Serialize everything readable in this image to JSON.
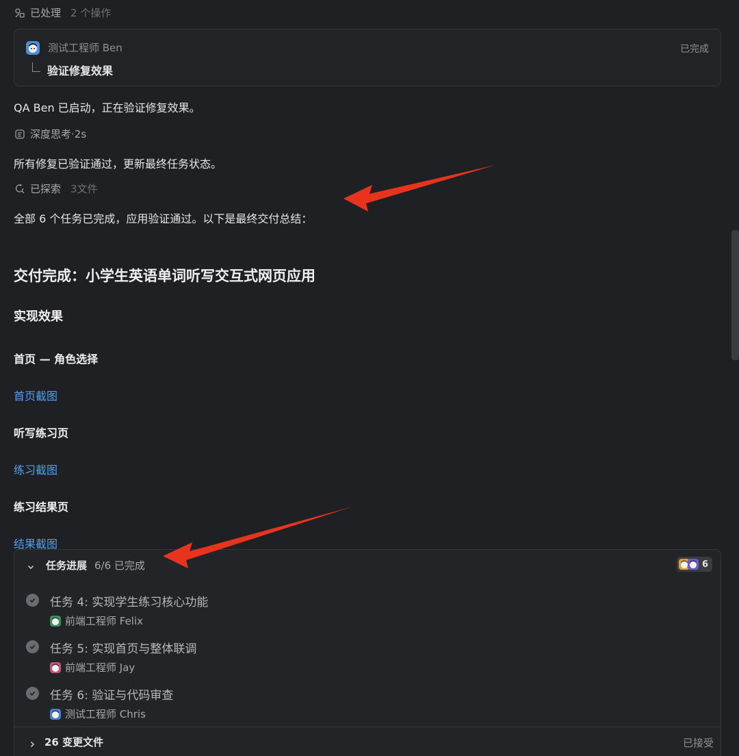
{
  "processed": {
    "label": "已处理",
    "count": "2 个操作",
    "icon": "tools-icon"
  },
  "subtask_card": {
    "agent_name": "测试工程师 Ben",
    "status": "已完成",
    "task": "验证修复效果",
    "avatar_color": "#4a90d9"
  },
  "message_1": "QA Ben 已启动，正在验证修复效果。",
  "thinking": {
    "label": "深度思考",
    "separator": " · ",
    "duration": "2s",
    "icon": "brain-icon"
  },
  "message_2": "所有修复已验证通过，更新最终任务状态。",
  "explored": {
    "label": "已探索",
    "count": "3文件",
    "icon": "search-refresh-icon"
  },
  "message_3": "全部 6 个任务已完成，应用验证通过。以下是最终交付总结：",
  "delivery": {
    "title": "交付完成：小学生英语单词听写交互式网页应用",
    "section": "实现效果",
    "home_heading": "首页 — 角色选择",
    "home_link": "首页截图",
    "practice_heading": "听写练习页",
    "practice_link": "练习截图",
    "result_heading": "练习结果页",
    "result_link": "结果截图"
  },
  "task_panel": {
    "title": "任务进展",
    "progress": "6/6 已完成",
    "agent_count": "6",
    "tasks": [
      {
        "name": "任务 4: 实现学生练习核心功能",
        "owner": "前端工程师 Felix",
        "avatar_color": "#3f8f5a"
      },
      {
        "name": "任务 5: 实现首页与整体联调",
        "owner": "前端工程师 Jay",
        "avatar_color": "#c2567a"
      },
      {
        "name": "任务 6: 验证与代码审查",
        "owner": "测试工程师 Chris",
        "avatar_color": "#4a7fd0"
      }
    ]
  },
  "changes": {
    "label": "26 变更文件",
    "status": "已接受"
  },
  "colors": {
    "background": "#1f2023",
    "link": "#4ea1f0",
    "annotation_arrow": "#e8341c"
  }
}
